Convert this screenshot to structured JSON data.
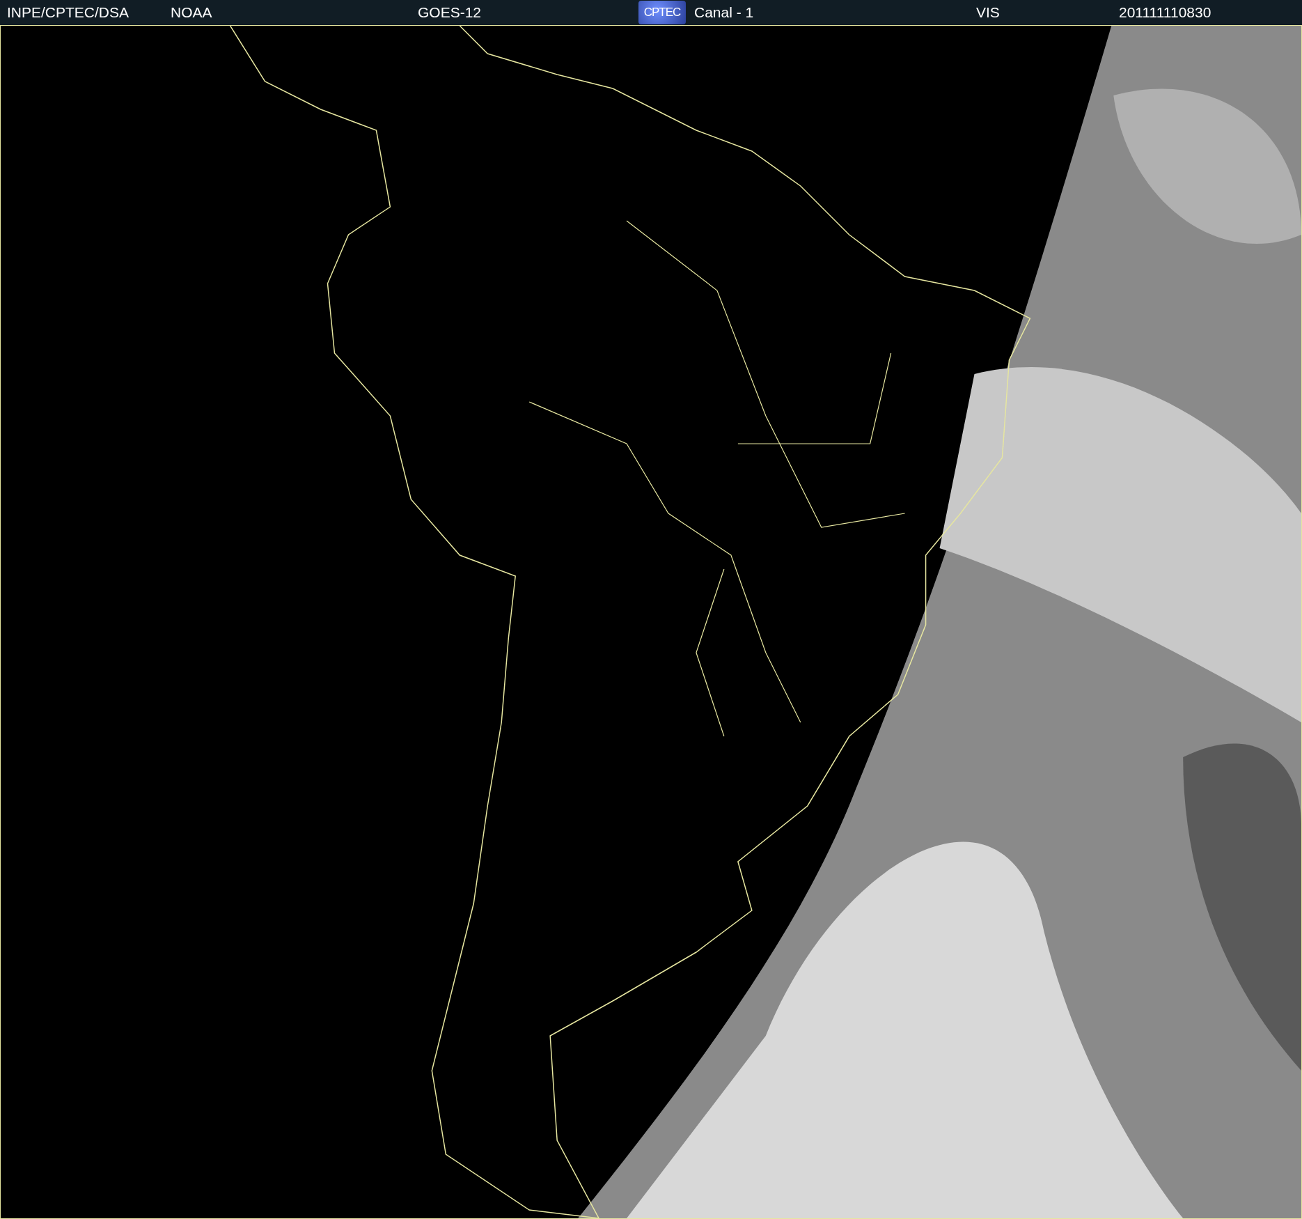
{
  "header": {
    "items": [
      {
        "kind": "text",
        "label": "INPE/CPTEC/DSA"
      },
      {
        "kind": "text",
        "label": "NOAA"
      },
      {
        "kind": "text",
        "label": "GOES-12"
      },
      {
        "kind": "logo",
        "label": "CPTEC"
      },
      {
        "kind": "text",
        "label": "Canal - 1"
      },
      {
        "kind": "text",
        "label": "VIS"
      },
      {
        "kind": "text",
        "label": "201111110830"
      }
    ]
  }
}
